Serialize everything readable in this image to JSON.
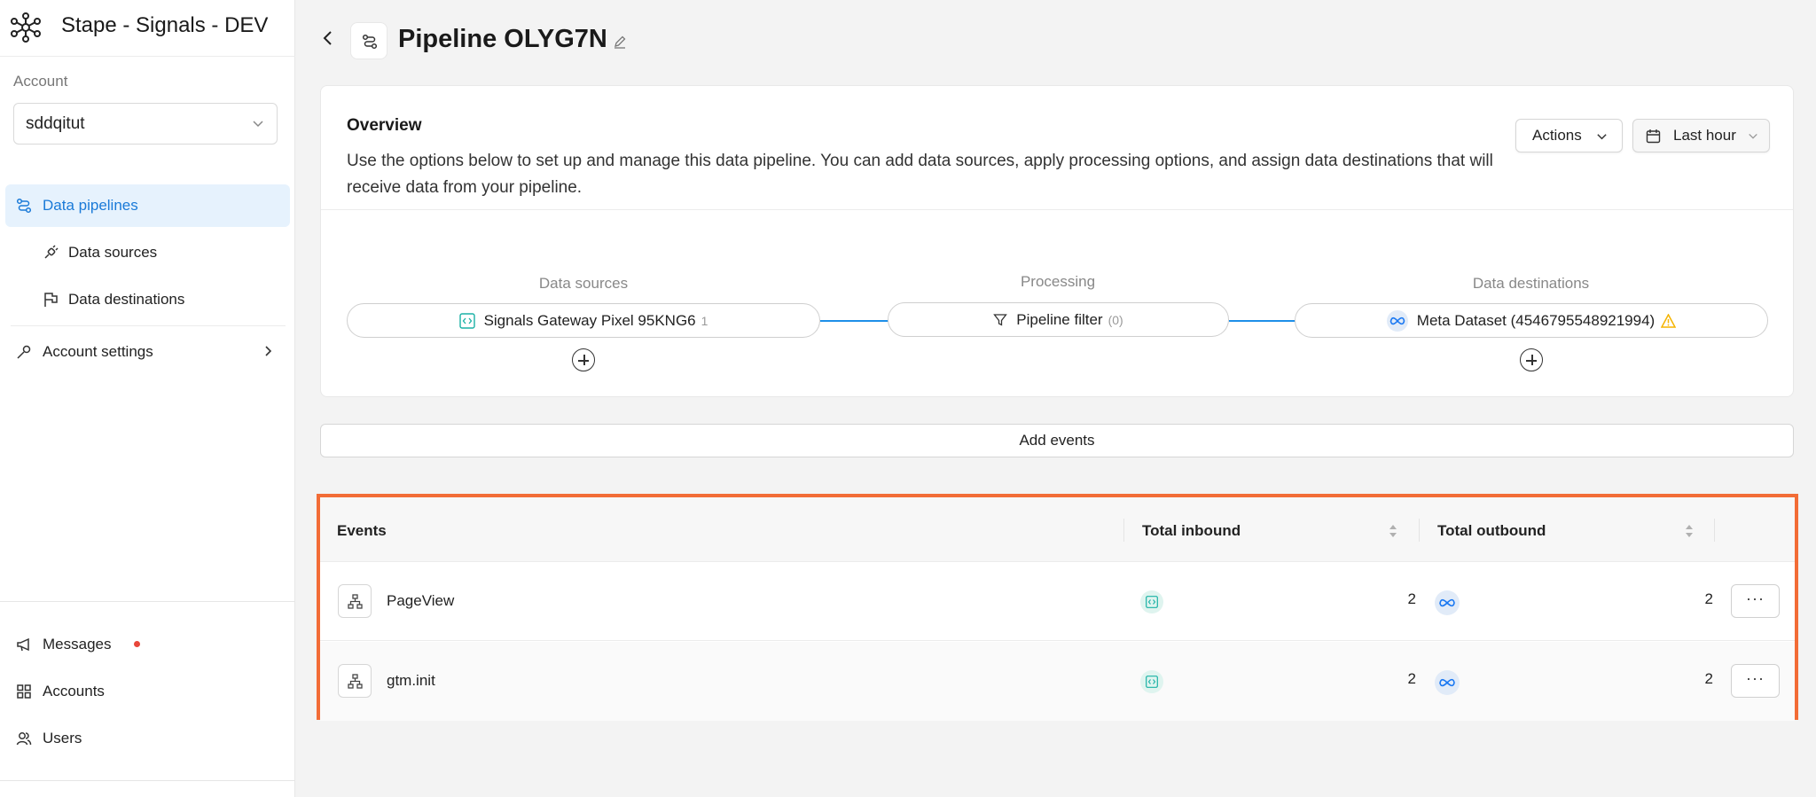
{
  "app": {
    "title": "Stape - Signals - DEV"
  },
  "account": {
    "label": "Account",
    "selected": "sddqitut"
  },
  "nav": {
    "data_pipelines": "Data pipelines",
    "data_sources": "Data sources",
    "data_destinations": "Data destinations",
    "account_settings": "Account settings",
    "messages": "Messages",
    "accounts": "Accounts",
    "users": "Users"
  },
  "page": {
    "title": "Pipeline OLYG7N"
  },
  "overview": {
    "title": "Overview",
    "description": "Use the options below to set up and manage this data pipeline. You can add data sources, apply processing options, and assign data destinations that will receive data from your pipeline.",
    "actions_label": "Actions",
    "time_label": "Last hour"
  },
  "flow": {
    "sources_label": "Data sources",
    "processing_label": "Processing",
    "destinations_label": "Data destinations",
    "source_name": "Signals Gateway Pixel 95KNG6",
    "source_count": "1",
    "filter_name": "Pipeline filter",
    "filter_count": "(0)",
    "destination_name": "Meta Dataset (4546795548921994)"
  },
  "add_events_label": "Add events",
  "table": {
    "headers": {
      "events": "Events",
      "inbound": "Total inbound",
      "outbound": "Total outbound"
    },
    "rows": [
      {
        "name": "PageView",
        "inbound": "2",
        "outbound": "2",
        "more": "···"
      },
      {
        "name": "gtm.init",
        "inbound": "2",
        "outbound": "2",
        "more": "···"
      }
    ]
  },
  "colors": {
    "accent": "#1a7ad8",
    "highlight_border": "#f26c36",
    "connector": "#1e8fe8",
    "warning": "#f5b400"
  }
}
